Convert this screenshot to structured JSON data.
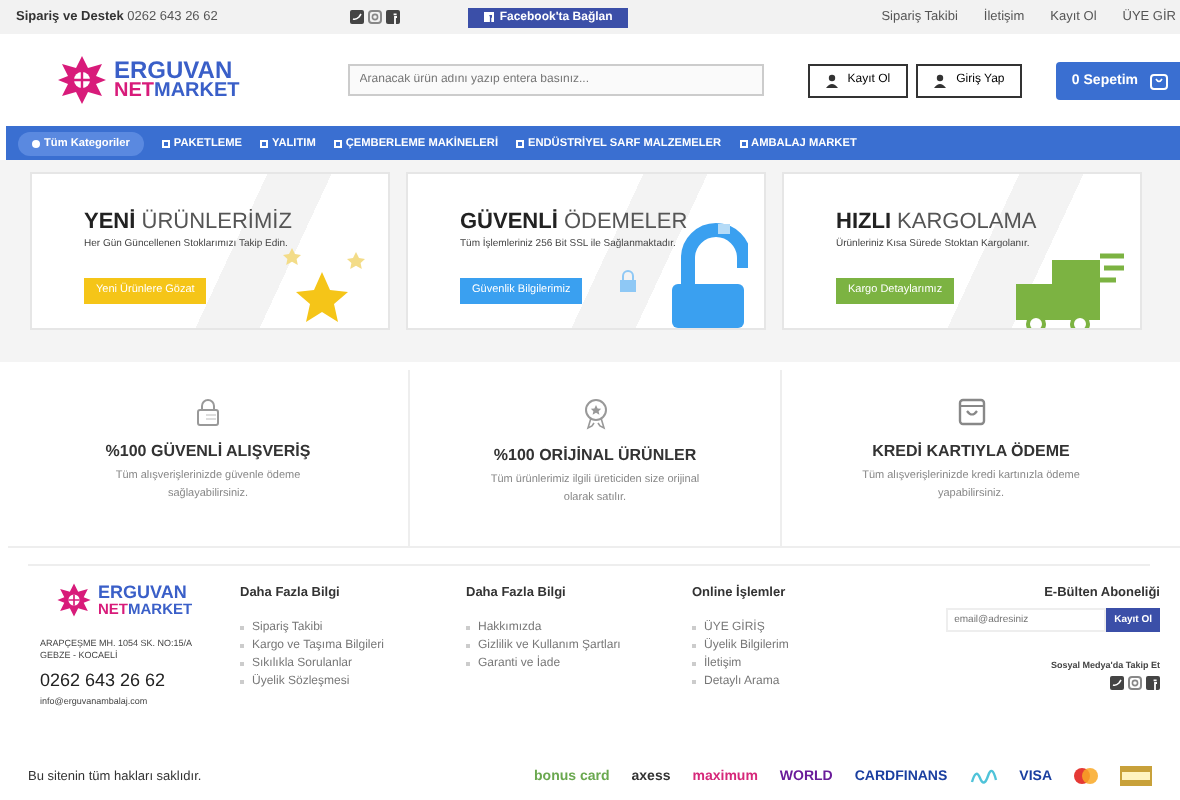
{
  "top_bar": {
    "support_label": "Sipariş ve Destek",
    "support_phone": "0262 643 26 62",
    "facebook_button": "Facebook'ta Bağlan",
    "links": [
      "Sipariş Takibi",
      "İletişim",
      "Kayıt Ol",
      "ÜYE GİR"
    ]
  },
  "header": {
    "logo_top": "ERGUVAN",
    "logo_bottom": "NETMARKET",
    "search": {
      "placeholder": "Aranacak ürün adını yazıp entera basınız..."
    },
    "register_button": "Kayıt Ol",
    "login_button": "Giriş Yap",
    "cart_button": "0 Sepetim"
  },
  "nav": [
    {
      "label": "Tüm Kategoriler",
      "kind": "all"
    },
    {
      "label": "PAKETLEME",
      "kind": "category"
    },
    {
      "label": "YALITIM",
      "kind": "category"
    },
    {
      "label": "ÇEMBERLEME MAKİNELERİ",
      "kind": "category"
    },
    {
      "label": "ENDÜSTRİYEL SARF MALZEMELER",
      "kind": "category"
    },
    {
      "label": "AMBALAJ MARKET",
      "kind": "category"
    }
  ],
  "banners": [
    {
      "kind": "stars",
      "title": "**YENİ** ÜRÜNLERİMİZ",
      "text": "Her Gün Güncellenen Stoklarımızı Takip Edin.",
      "button": "Yeni Ürünlere Gözat",
      "color": "#f5c518"
    },
    {
      "kind": "lock",
      "title": "**GÜVENLİ** ÖDEMELER",
      "text": "Tüm İşlemleriniz 256 Bit SSL ile Sağlanmaktadır.",
      "button": "Güvenlik Bilgilerimiz",
      "color": "#3aa0f0"
    },
    {
      "kind": "truck",
      "title": "**HIZLI** KARGOLAMA",
      "text": "Ürünleriniz Kısa Sürede Stoktan Kargolanır.",
      "button": "Kargo Detaylarımız",
      "color": "#7cb342"
    }
  ],
  "features": [
    {
      "kind": "padlock",
      "title": "%100 GÜVENLİ ALIŞVERİŞ",
      "text": "Tüm alışverişlerinizde güvenle ödeme sağlayabilirsiniz."
    },
    {
      "kind": "award",
      "title": "%100 ORİJİNAL ÜRÜNLER",
      "text": "Tüm ürünlerimiz ilgili üreticiden size orijinal olarak satılır."
    },
    {
      "kind": "bag",
      "title": "KREDİ KARTIYLA ÖDEME",
      "text": "Tüm alışverişlerinizde kredi kartınızla ödeme yapabilirsiniz."
    }
  ],
  "footer": {
    "logo_top": "ERGUVAN",
    "logo_bottom": "NETMARKET",
    "address": [
      "ARAPÇEŞME MH. 1054 SK. NO:15/A",
      "GEBZE - KOCAELİ"
    ],
    "phone": "0262 643 26 62",
    "email": "info@erguvanambalaj.com",
    "columns": [
      {
        "title": "Daha Fazla Bilgi",
        "links": [
          "Sipariş Takibi",
          "Kargo ve Taşıma Bilgileri",
          "Sıkılıkla Sorulanlar",
          "Üyelik Sözleşmesi"
        ]
      },
      {
        "title": "Daha Fazla Bilgi",
        "links": [
          "Hakkımızda",
          "Gizlilik ve Kullanım Şartları",
          "Garanti ve İade"
        ]
      },
      {
        "title": "Online İşlemler",
        "links": [
          "ÜYE GİRİŞ",
          "Üyelik Bilgilerim",
          "İletişim",
          "Detaylı Arama"
        ]
      }
    ],
    "newsletter": {
      "title": "E-Bülten Aboneliği",
      "placeholder": "email@adresiniz",
      "button": "Kayıt Ol"
    },
    "social_label": "Sosyal Medya'da Takip Et",
    "copyright": "Bu sitenin tüm hakları saklıdır.",
    "payment_logos": [
      {
        "label": "bonus card",
        "color": "#6aa84f"
      },
      {
        "label": "axess",
        "color": "#333333"
      },
      {
        "label": "maximum",
        "color": "#d6287a"
      },
      {
        "label": "WORLD",
        "color": "#6a1b9a"
      },
      {
        "label": "CARDFINANS",
        "color": "#1a3fa0"
      },
      {
        "label": "VISA",
        "color": "#1a3fa0"
      }
    ]
  }
}
